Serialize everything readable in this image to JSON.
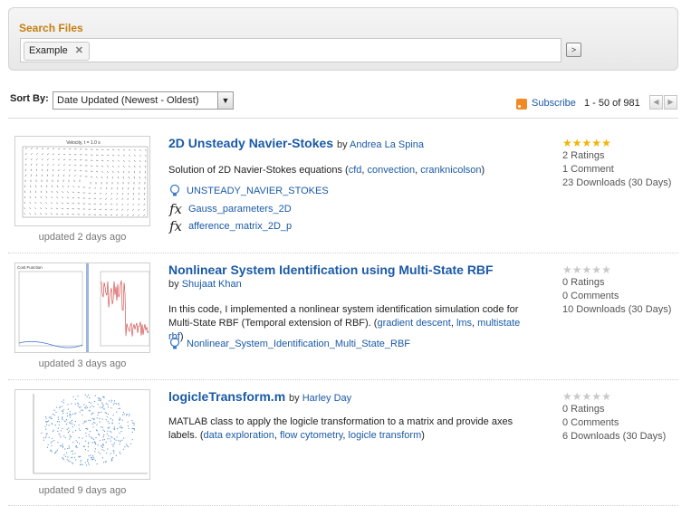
{
  "search": {
    "title": "Search Files",
    "token": "Example",
    "go_label": ">"
  },
  "sort": {
    "label": "Sort By:",
    "value": "Date Updated (Newest - Oldest)"
  },
  "subscribe": "Subscribe",
  "pager": {
    "range": "1 - 50 of 981",
    "prev": "◀",
    "next": "▶"
  },
  "results": [
    {
      "title": "2D Unsteady Navier-Stokes",
      "by": "by",
      "author": "Andrea La Spina",
      "desc_prefix": "Solution of 2D Navier-Stokes equations (",
      "tags": [
        "cfd",
        "convection",
        "cranknicolson"
      ],
      "desc_suffix": ")",
      "files": [
        {
          "icon": "lightbulb-icon",
          "name": "UNSTEADY_NAVIER_STOKES"
        },
        {
          "icon": "fx-icon",
          "name": "Gauss_parameters_2D"
        },
        {
          "icon": "fx-icon",
          "name": "afference_matrix_2D_p"
        }
      ],
      "updated": "updated 2 days ago",
      "rating_stars": 5,
      "ratings": "2 Ratings",
      "comments": "1 Comment",
      "downloads": "23 Downloads (30 Days)",
      "thumb_title": "Velocity, t = 1.0 s"
    },
    {
      "title": "Nonlinear System Identification using Multi-State RBF",
      "by": "by",
      "author": "Shujaat Khan",
      "desc_prefix": "In this code, I implemented a nonlinear system identification simulation code for Multi-State RBF (Temporal extension of RBF). (",
      "tags": [
        "gradient descent",
        "lms",
        "multistate rbf"
      ],
      "desc_suffix": ")",
      "files": [
        {
          "icon": "lightbulb-icon",
          "name": "Nonlinear_System_Identification_Multi_State_RBF"
        }
      ],
      "updated": "updated 3 days ago",
      "rating_stars": 0,
      "ratings": "0 Ratings",
      "comments": "0 Comments",
      "downloads": "10 Downloads (30 Days)",
      "thumb_title": "Cost Function"
    },
    {
      "title": "logicleTransform.m",
      "by": "by",
      "author": "Harley Day",
      "desc_prefix": "MATLAB class to apply the logicle transformation to a matrix and provide axes labels. (",
      "tags": [
        "data exploration",
        "flow cytometry",
        "logicle transform"
      ],
      "desc_suffix": ")",
      "files": [],
      "updated": "updated 9 days ago",
      "rating_stars": 0,
      "ratings": "0 Ratings",
      "comments": "0 Comments",
      "downloads": "6 Downloads (30 Days)"
    }
  ],
  "colors": {
    "accent_orange": "#c57f12",
    "link_blue": "#1a5aa6",
    "star_gold": "#f2b407",
    "star_grey": "#c9c9c9",
    "rss_orange": "#f08a24"
  }
}
